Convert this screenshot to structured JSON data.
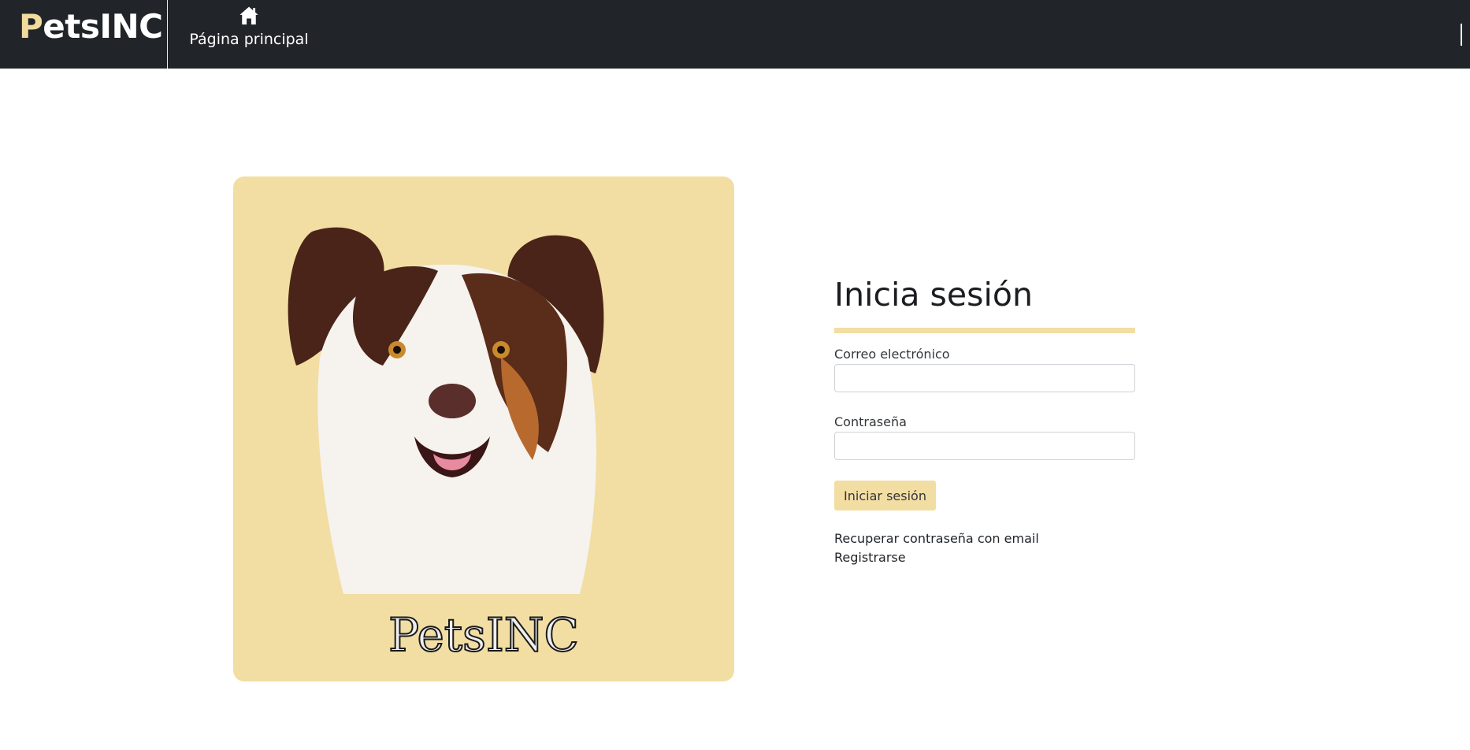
{
  "brand": {
    "first_letter": "P",
    "rest": "etsINC",
    "accent_color": "#f0dc9e"
  },
  "nav": {
    "home_icon": "home-icon",
    "home_label": "Página principal"
  },
  "card": {
    "image": "dog-portrait",
    "logo_text": "PetsINC",
    "background_color": "#f2dea3"
  },
  "login": {
    "title": "Inicia sesión",
    "email_label": "Correo electrónico",
    "email_value": "",
    "password_label": "Contraseña",
    "password_value": "",
    "submit_label": "Iniciar sesión",
    "recover_link": "Recuperar contraseña con email",
    "register_link": "Registrarse"
  },
  "colors": {
    "navbar": "#212529",
    "accent": "#f2dea3"
  }
}
